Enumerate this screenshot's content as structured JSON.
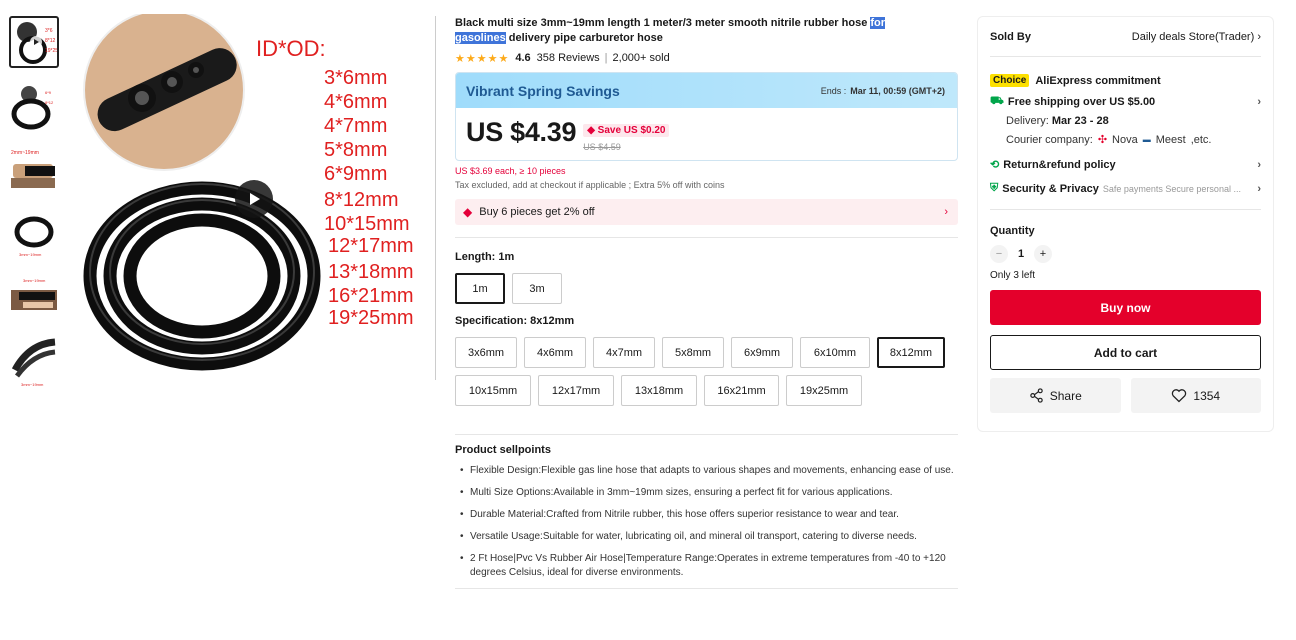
{
  "gallery": {
    "thumbs": [
      "thumb-1",
      "thumb-2",
      "thumb-3",
      "thumb-4",
      "thumb-5",
      "thumb-6"
    ],
    "overlay_title": "ID*OD:",
    "sizes": [
      "3*6mm",
      "4*6mm",
      "4*7mm",
      "5*8mm",
      "6*9mm",
      "8*12mm",
      "10*15mm",
      "12*17mm",
      "13*18mm",
      "16*21mm",
      "19*25mm"
    ],
    "play_icon": "play-icon"
  },
  "product": {
    "title_pre": "Black multi size 3mm~19mm length 1 meter/3 meter smooth nitrile rubber hose ",
    "title_highlight_1": "for",
    "title_highlight_2": "gasolines",
    "title_post": " delivery pipe carburetor hose",
    "rating": "4.6",
    "reviews": "358 Reviews",
    "sold": "2,000+ sold"
  },
  "promo": {
    "name": "Vibrant Spring Savings",
    "ends_label": "Ends :",
    "ends_value": "Mar 11, 00:59 (GMT+2)",
    "price": "US $4.39",
    "save": "Save US $0.20",
    "original": "US $4.59",
    "bulk": "US $3.69 each, ≥ 10 pieces",
    "tax": "Tax excluded, add at checkout if applicable ; Extra 5% off with coins",
    "coupon": "Buy 6 pieces get 2% off"
  },
  "length": {
    "label": "Length: 1m",
    "options": [
      "1m",
      "3m"
    ],
    "selected": "1m"
  },
  "spec": {
    "label": "Specification: 8x12mm",
    "options": [
      "3x6mm",
      "4x6mm",
      "4x7mm",
      "5x8mm",
      "6x9mm",
      "6x10mm",
      "8x12mm",
      "10x15mm",
      "12x17mm",
      "13x18mm",
      "16x21mm",
      "19x25mm"
    ],
    "selected": "8x12mm"
  },
  "sellpoints": {
    "title": "Product sellpoints",
    "items": [
      "Flexible Design:Flexible gas line hose that adapts to various shapes and movements, enhancing ease of use.",
      "Multi Size Options:Available in 3mm~19mm sizes, ensuring a perfect fit for various applications.",
      "Durable Material:Crafted from Nitrile rubber, this hose offers superior resistance to wear and tear.",
      "Versatile Usage:Suitable for water, lubricating oil, and mineral oil transport, catering to diverse needs.",
      "2 Ft Hose|Pvc Vs Rubber Air Hose|Temperature Range:Operates in extreme temperatures from -40 to +120 degrees Celsius, ideal for diverse environments."
    ]
  },
  "side": {
    "sold_by_label": "Sold By",
    "store": "Daily deals Store(Trader)",
    "choice_badge": "Choice",
    "commitment": "AliExpress commitment",
    "shipping": "Free shipping over US $5.00",
    "delivery_label": "Delivery:",
    "delivery_value": "Mar 23 - 28",
    "courier_label": "Courier company:",
    "courier_1": "Nova",
    "courier_2": "Meest",
    "courier_etc": ",etc.",
    "return": "Return&refund policy",
    "security": "Security & Privacy",
    "security_sub": "Safe payments Secure personal ...",
    "qty_label": "Quantity",
    "qty_value": "1",
    "stock": "Only 3 left",
    "buy": "Buy now",
    "cart": "Add to cart",
    "share": "Share",
    "likes": "1354"
  },
  "colors": {
    "accent_red": "#e4002b",
    "promo_blue": "#1f5a93",
    "choice_yellow": "#fde000",
    "highlight": "#3f74d9"
  }
}
